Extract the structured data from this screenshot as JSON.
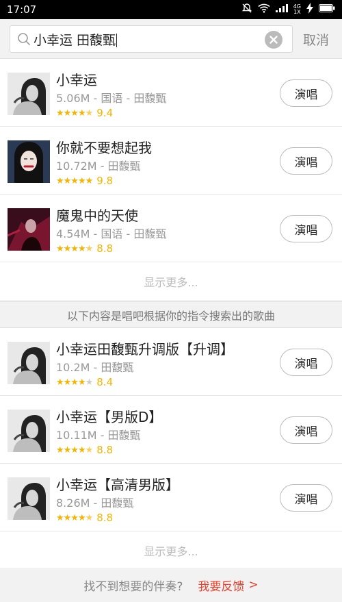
{
  "status_bar": {
    "time": "17:07",
    "network_top": "4G",
    "network_bottom": "1X"
  },
  "search": {
    "query": "小幸运 田馥甄",
    "cancel_label": "取消"
  },
  "results": [
    {
      "title": "小幸运",
      "meta": "5.06M - 国语 - 田馥甄",
      "score": "9.4",
      "stars": 4.5,
      "sing_label": "演唱"
    },
    {
      "title": "你就不要想起我",
      "meta": "10.72M - 田馥甄",
      "score": "9.8",
      "stars": 5,
      "sing_label": "演唱"
    },
    {
      "title": "魔鬼中的天使",
      "meta": "4.54M - 国语 - 田馥甄",
      "score": "8.8",
      "stars": 4.5,
      "sing_label": "演唱"
    }
  ],
  "show_more_label": "显示更多...",
  "section_note": "以下内容是唱吧根据你的指令搜索出的歌曲",
  "suggestions": [
    {
      "title": "小幸运田馥甄升调版【升调】",
      "meta": "10.2M - 田馥甄",
      "score": "8.4",
      "stars": 4,
      "sing_label": "演唱"
    },
    {
      "title": "小幸运【男版D】",
      "meta": "10.11M - 田馥甄",
      "score": "8.8",
      "stars": 4.5,
      "sing_label": "演唱"
    },
    {
      "title": "小幸运【高清男版】",
      "meta": "8.26M - 田馥甄",
      "score": "8.8",
      "stars": 4.5,
      "sing_label": "演唱"
    }
  ],
  "show_more_label_2": "显示更多...",
  "footer": {
    "question": "找不到想要的伴奏?",
    "feedback": "我要反馈"
  },
  "colors": {
    "accent_red": "#e8402b",
    "star_yellow": "#f5b400"
  }
}
